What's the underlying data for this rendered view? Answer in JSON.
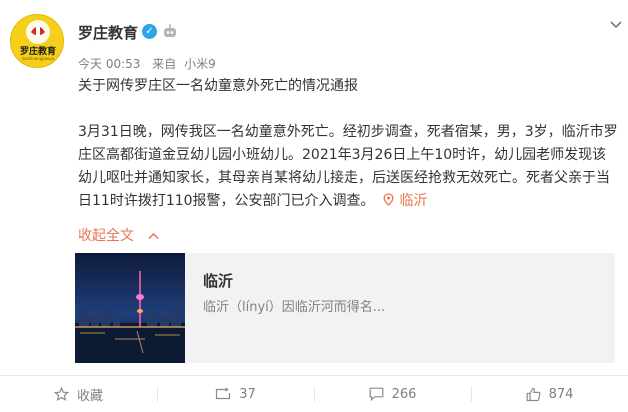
{
  "post": {
    "author": {
      "name": "罗庄教育",
      "avatar_text": "罗庄教育",
      "avatar_subtext": "luozhuangjiaoyu"
    },
    "meta": {
      "time": "今天 00:53",
      "source_prefix": "来自",
      "source": "小米9"
    },
    "title_line": "关于网传罗庄区一名幼童意外死亡的情况通报",
    "body": "3月31日晚，网传我区一名幼童意外死亡。经初步调查，死者宿某，男，3岁，临沂市罗庄区高都街道金豆幼儿园小班幼儿。2021年3月26日上午10时许，幼儿园老师发现该幼儿呕吐并通知家长，其母亲肖某将幼儿接走，后送医经抢救无效死亡。死者父亲于当日11时许拨打110报警，公安部门已介入调查。",
    "location": "临沂",
    "collapse_label": "收起全文",
    "card": {
      "title": "临沂",
      "description": "临沂（línyí）因临沂河而得名..."
    },
    "actions": {
      "favorite": "收藏",
      "repost": "37",
      "comment": "266",
      "like": "874"
    }
  },
  "colors": {
    "accent": "#eb7350",
    "verified": "#2aa6e7",
    "avatar_bg": "#f6cf1b",
    "muted": "#808080"
  },
  "icons": [
    "verified-icon",
    "robot-icon",
    "chevron-down-icon",
    "location-pin-icon",
    "chevron-up-icon",
    "star-icon",
    "repost-icon",
    "comment-icon",
    "thumbs-up-icon"
  ]
}
